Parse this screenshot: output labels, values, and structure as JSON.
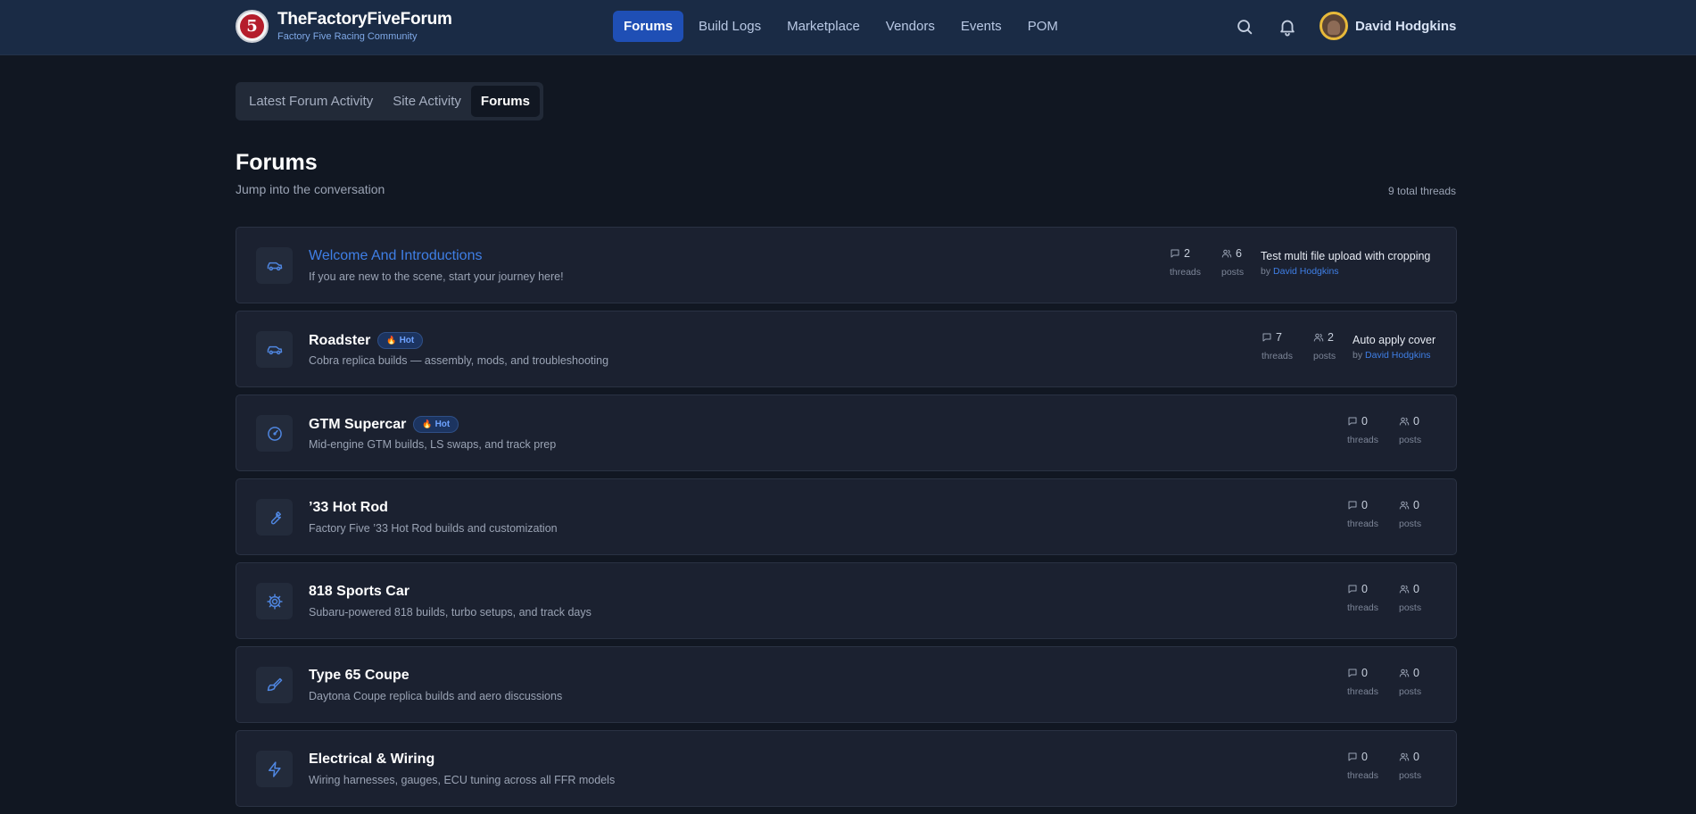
{
  "brand": {
    "title": "TheFactoryFiveForum",
    "subtitle": "Factory Five Racing Community",
    "logo_text": "5"
  },
  "nav": [
    {
      "label": "Forums",
      "active": true
    },
    {
      "label": "Build Logs"
    },
    {
      "label": "Marketplace"
    },
    {
      "label": "Vendors"
    },
    {
      "label": "Events"
    },
    {
      "label": "POM"
    }
  ],
  "header_icons": [
    "search-icon",
    "bell-icon"
  ],
  "user": {
    "name": "David Hodgkins"
  },
  "tabs": [
    {
      "label": "Latest Forum Activity"
    },
    {
      "label": "Site Activity"
    },
    {
      "label": "Forums",
      "active": true
    }
  ],
  "page": {
    "title": "Forums",
    "subtitle": "Jump into the conversation",
    "total_threads": "9 total threads"
  },
  "labels": {
    "threads": "threads",
    "posts": "posts",
    "by": "by"
  },
  "forums": [
    {
      "name": "Welcome And Introductions",
      "desc": "If you are new to the scene, start your journey here!",
      "icon": "car-icon",
      "threads": "2",
      "posts": "6",
      "hot": "",
      "latest_title": "Test multi file upload with cropping",
      "latest_author": "David Hodgkins",
      "highlight": true
    },
    {
      "name": "Roadster",
      "desc": "Cobra replica builds — assembly, mods, and troubleshooting",
      "icon": "car-icon",
      "threads": "7",
      "posts": "2",
      "hot": "Hot",
      "latest_title": "Auto apply cover",
      "latest_author": "David Hodgkins"
    },
    {
      "name": "GTM Supercar",
      "desc": "Mid-engine GTM builds, LS swaps, and track prep",
      "icon": "gauge-icon",
      "threads": "0",
      "posts": "0",
      "hot": "Hot"
    },
    {
      "name": "’33 Hot Rod",
      "desc": "Factory Five ’33 Hot Rod builds and customization",
      "icon": "wrench-icon",
      "threads": "0",
      "posts": "0",
      "hot": ""
    },
    {
      "name": "818 Sports Car",
      "desc": "Subaru-powered 818 builds, turbo setups, and track days",
      "icon": "gear-icon",
      "threads": "0",
      "posts": "0",
      "hot": ""
    },
    {
      "name": "Type 65 Coupe",
      "desc": "Daytona Coupe replica builds and aero discussions",
      "icon": "paintbrush-icon",
      "threads": "0",
      "posts": "0",
      "hot": ""
    },
    {
      "name": "Electrical & Wiring",
      "desc": "Wiring harnesses, gauges, ECU tuning across all FFR models",
      "icon": "lightning-icon",
      "threads": "0",
      "posts": "0",
      "hot": ""
    }
  ]
}
